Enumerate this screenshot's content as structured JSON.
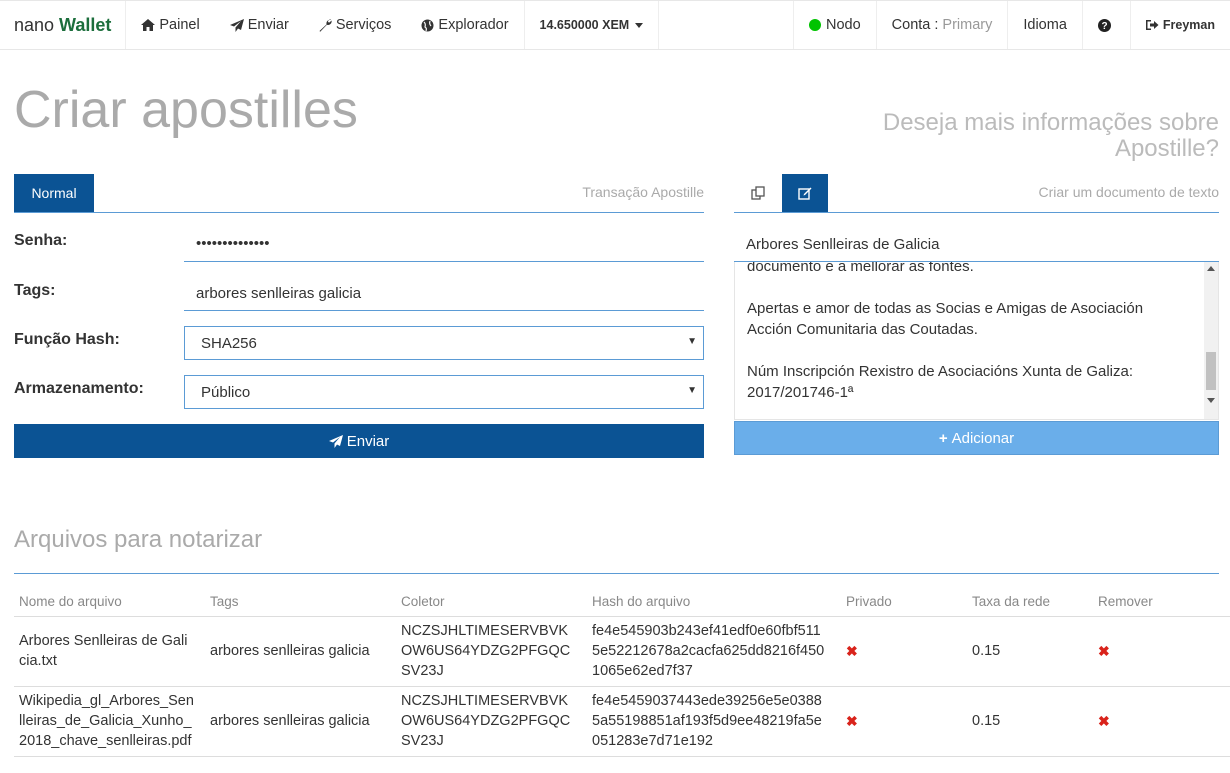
{
  "navbar": {
    "brand_prefix": "nano",
    "brand_bold": "Wallet",
    "painel": "Painel",
    "enviar": "Enviar",
    "servicos": "Serviços",
    "explorador": "Explorador",
    "balance": "14.650000 XEM",
    "nodo": "Nodo",
    "conta_label": "Conta :",
    "conta_value": "Primary",
    "idioma": "Idioma",
    "user": "Freyman",
    "status_color": "#00c300"
  },
  "page": {
    "title": "Criar apostilles",
    "help_line1": "Deseja mais informações sobre",
    "help_line2": "Apostille?"
  },
  "left": {
    "tab_normal": "Normal",
    "caption": "Transação Apostille",
    "senha_label": "Senha:",
    "senha_value": "••••••••••••••",
    "tags_label": "Tags:",
    "tags_value": "arbores senlleiras galicia",
    "hash_label": "Função Hash:",
    "hash_value": "SHA256",
    "storage_label": "Armazenamento:",
    "storage_value": "Público",
    "send_button": "Enviar"
  },
  "right": {
    "caption": "Criar um documento de texto",
    "doc_title": "Arbores Senlleiras de Galicia",
    "doc_line_partial": "documento e a mellorar as fontes.",
    "doc_para2_l1": "Apertas e amor de todas as Socias e Amigas de Asociación",
    "doc_para2_l2": "Acción Comunitaria das Coutadas.",
    "doc_para3_l1": "Núm Inscripción Rexistro de Asociacións Xunta de Galiza:",
    "doc_para3_l2": "2017/201746-1ª",
    "add_button": "Adicionar"
  },
  "files": {
    "title": "Arquivos para notarizar",
    "headers": [
      "Nome do arquivo",
      "Tags",
      "Coletor",
      "Hash do arquivo",
      "Privado",
      "Taxa da rede",
      "Remover"
    ],
    "rows": [
      {
        "name_l1": "Arbores Senlleiras de Gali",
        "name_l2": "cia.txt",
        "name_l3": "",
        "tags": "arbores senlleiras galicia",
        "col_l1": "NCZSJHLTIMESERVBVK",
        "col_l2": "OW6US64YDZG2PFGQC",
        "col_l3": "SV23J",
        "hash_l1": "fe4e545903b243ef41edf0e60fbf511",
        "hash_l2": "5e52212678a2cacfa625dd8216f450",
        "hash_l3": "1065e62ed7f37",
        "fee": "0.15"
      },
      {
        "name_l1": "Wikipedia_gl_Arbores_Sen",
        "name_l2": "lleiras_de_Galicia_Xunho_",
        "name_l3": "2018_chave_senlleiras.pdf",
        "tags": "arbores senlleiras galicia",
        "col_l1": "NCZSJHLTIMESERVBVK",
        "col_l2": "OW6US64YDZG2PFGQC",
        "col_l3": "SV23J",
        "hash_l1": "fe4e5459037443ede39256e5e0388",
        "hash_l2": "5a55198851af193f5d9ee48219fa5e",
        "hash_l3": "051283e7d71e192",
        "fee": "0.15"
      }
    ],
    "private_mark": "✖",
    "remove_mark": "✖"
  }
}
